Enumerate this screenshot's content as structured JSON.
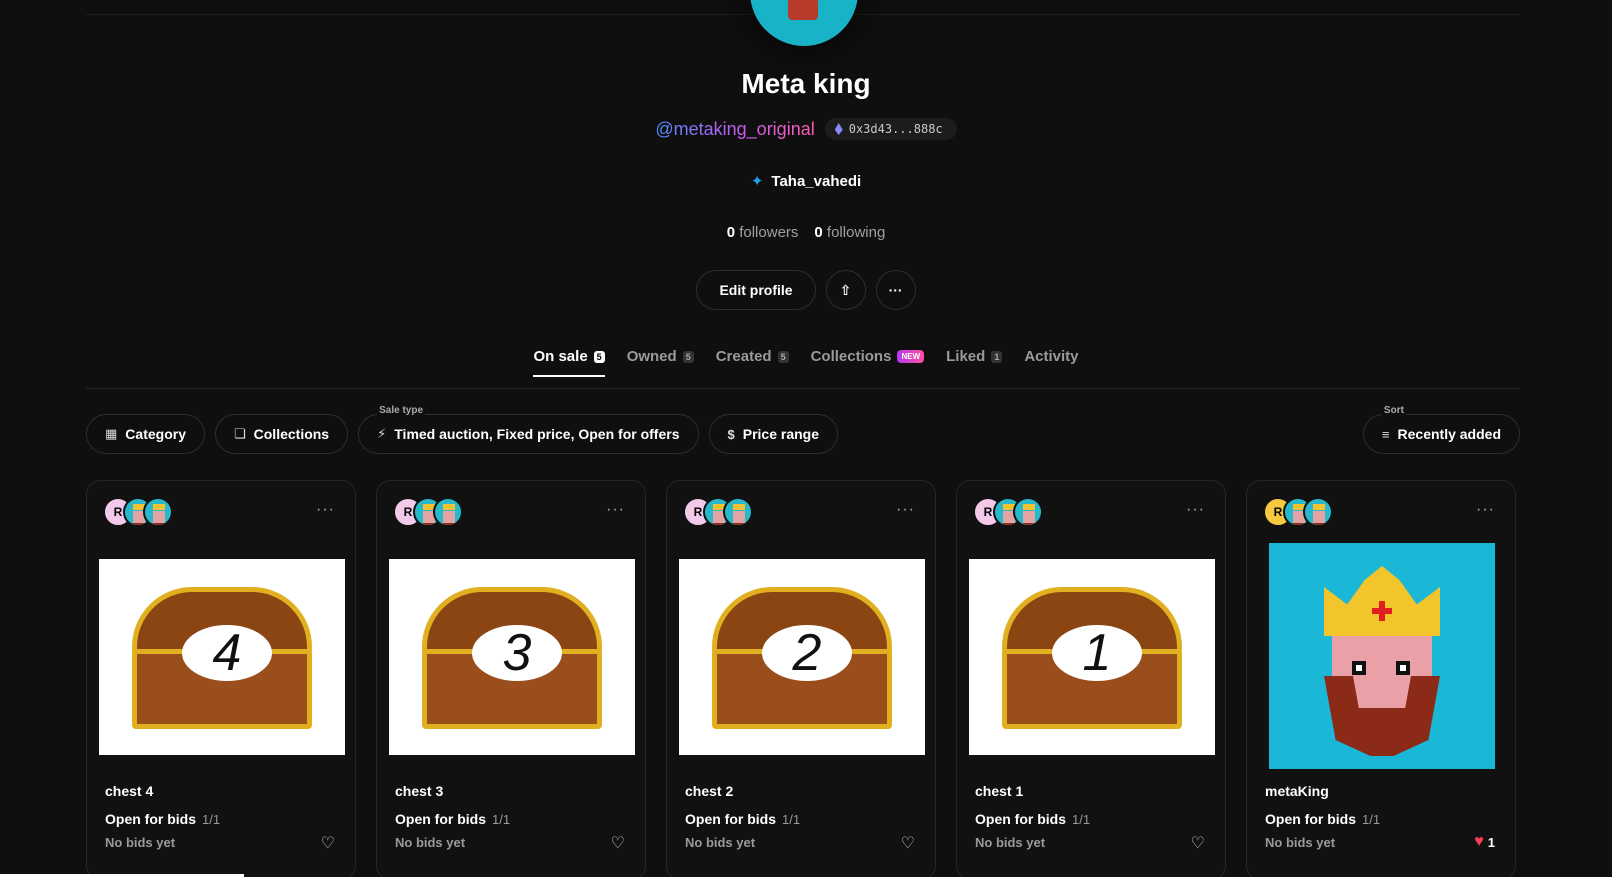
{
  "profile": {
    "name": "Meta king",
    "handle": "@metaking_original",
    "wallet": "0x3d43...888c",
    "twitter": "Taha_vahedi",
    "followers_count": "0",
    "followers_label": "followers",
    "following_count": "0",
    "following_label": "following"
  },
  "actions": {
    "edit_profile": "Edit profile",
    "share_icon": "share-icon",
    "more_icon": "more-icon"
  },
  "tabs": [
    {
      "label": "On sale",
      "count": "5",
      "active": true
    },
    {
      "label": "Owned",
      "count": "5"
    },
    {
      "label": "Created",
      "count": "5"
    },
    {
      "label": "Collections",
      "badge": "NEW"
    },
    {
      "label": "Liked",
      "count": "1"
    },
    {
      "label": "Activity"
    }
  ],
  "filters": {
    "category": "Category",
    "collections": "Collections",
    "sale_type_caption": "Sale type",
    "sale_type": "Timed auction, Fixed price, Open for offers",
    "price_range": "Price range",
    "sort_caption": "Sort",
    "sort": "Recently added"
  },
  "cards": [
    {
      "title": "chest 4",
      "status": "Open for bids",
      "edition": "1/1",
      "bids": "No bids yet",
      "art_number": "4",
      "likes": ""
    },
    {
      "title": "chest 3",
      "status": "Open for bids",
      "edition": "1/1",
      "bids": "No bids yet",
      "art_number": "3",
      "likes": ""
    },
    {
      "title": "chest 2",
      "status": "Open for bids",
      "edition": "1/1",
      "bids": "No bids yet",
      "art_number": "2",
      "likes": ""
    },
    {
      "title": "chest 1",
      "status": "Open for bids",
      "edition": "1/1",
      "bids": "No bids yet",
      "art_number": "1",
      "likes": ""
    },
    {
      "title": "metaKing",
      "status": "Open for bids",
      "edition": "1/1",
      "bids": "No bids yet",
      "art_number": "",
      "likes": "1"
    }
  ],
  "owner_badge_letter": "R",
  "colors": {
    "background": "#0f0f0f",
    "accent_gradient": [
      "#4c8dff",
      "#c55cf6",
      "#ff5bb0"
    ],
    "like_red": "#ff3d55",
    "king_bg": "#1ab7d6"
  }
}
